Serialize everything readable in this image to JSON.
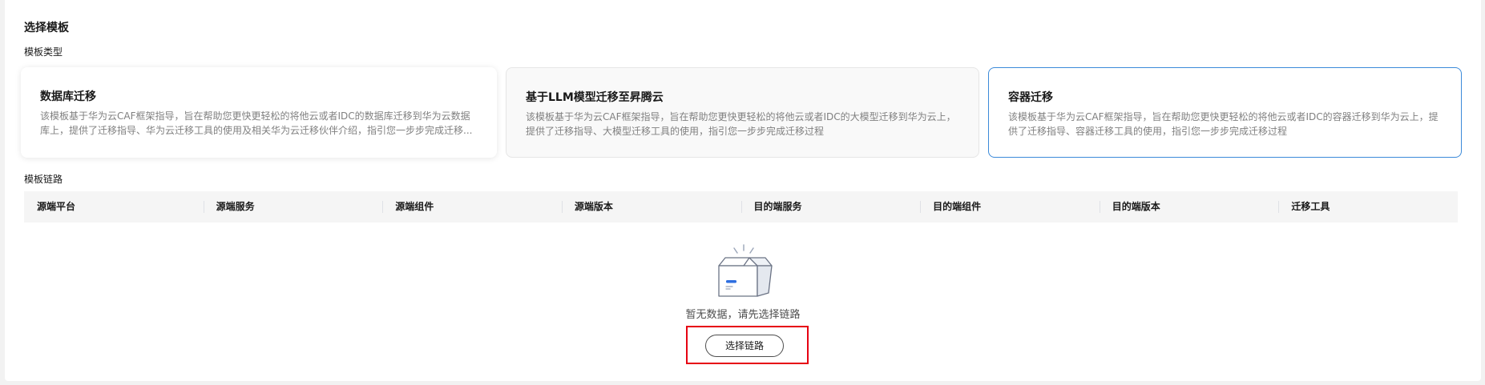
{
  "page_title": "选择模板",
  "template_type_label": "模板类型",
  "cards": [
    {
      "title": "数据库迁移",
      "description": "该模板基于华为云CAF框架指导，旨在帮助您更快更轻松的将他云或者IDC的数据库迁移到华为云数据库上，提供了迁移指导、华为云迁移工具的使用及相关华为云迁移伙伴介绍，指引您一步步完成迁移..."
    },
    {
      "title": "基于LLM模型迁移至昇腾云",
      "description": "该模板基于华为云CAF框架指导，旨在帮助您更快更轻松的将他云或者IDC的大模型迁移到华为云上，提供了迁移指导、大模型迁移工具的使用，指引您一步步完成迁移过程"
    },
    {
      "title": "容器迁移",
      "description": "该模板基于华为云CAF框架指导，旨在帮助您更快更轻松的将他云或者IDC的容器迁移到华为云上，提供了迁移指导、容器迁移工具的使用，指引您一步步完成迁移过程",
      "selected": true
    }
  ],
  "chain_label": "模板链路",
  "table": {
    "columns": [
      "源端平台",
      "源端服务",
      "源端组件",
      "源端版本",
      "目的端服务",
      "目的端组件",
      "目的端版本",
      "迁移工具"
    ]
  },
  "empty_state": {
    "icon": "empty-box-icon",
    "text": "暂无数据，请先选择链路",
    "button_label": "选择链路"
  },
  "colors": {
    "selected_border": "#3c8ad9",
    "highlight_border": "#e60012"
  }
}
